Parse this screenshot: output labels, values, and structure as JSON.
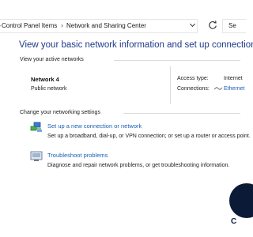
{
  "breadcrumb": {
    "items": [
      "Control Panel Items",
      "Network and Sharing Center"
    ],
    "separator": "›"
  },
  "search": {
    "visible_text": "Se"
  },
  "page_title": "View your basic network information and set up connections",
  "active_networks": {
    "heading": "View your active networks",
    "network_name": "Network 4",
    "network_category": "Public network",
    "access_type_label": "Access type:",
    "access_type_value": "Internet",
    "connections_label": "Connections:",
    "connections_value": "Ethernet"
  },
  "networking_settings": {
    "heading": "Change your networking settings",
    "tasks": [
      {
        "link": "Set up a new connection or network",
        "description": "Set up a broadband, dial-up, or VPN connection; or set up a router or access point.",
        "icon": "network-setup-icon"
      },
      {
        "link": "Troubleshoot problems",
        "description": "Diagnose and repair network problems, or get troubleshooting information.",
        "icon": "troubleshoot-icon"
      }
    ]
  },
  "overlay": {
    "letter": "C"
  },
  "colors": {
    "title": "#1e3a8a",
    "link": "#1a5fb4",
    "avatar": "#0b1a36"
  }
}
